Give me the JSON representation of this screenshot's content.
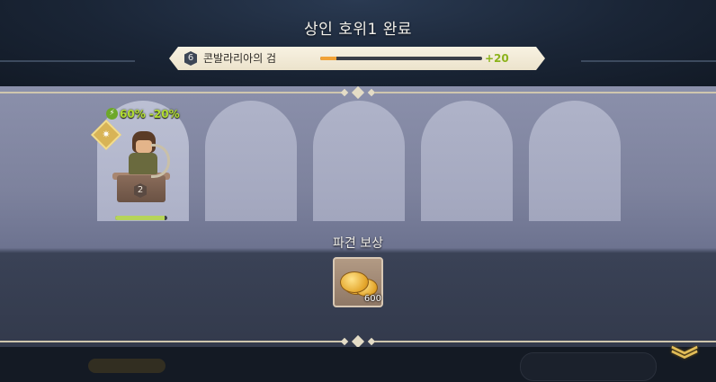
{
  "header": {
    "title": "상인 호위1 완료"
  },
  "info_bar": {
    "level": "6",
    "item_name": "콘발라리아의 검",
    "exp_progress": 0.1,
    "exp_gain": "+20"
  },
  "party": {
    "slots": [
      {
        "filled": true,
        "stat_text": "60% -20%",
        "hero_level": "2",
        "hp": 0.95
      },
      {
        "filled": false
      },
      {
        "filled": false
      },
      {
        "filled": false
      },
      {
        "filled": false
      }
    ]
  },
  "reward": {
    "title": "파견 보상",
    "item": "gold-coins-icon",
    "count": "600"
  },
  "footer": {
    "collapse_icon": "double-chevron-down-icon"
  },
  "colors": {
    "stat_green": "#b2dc33",
    "exp_fill": "#f1a236",
    "exp_gain": "#8db31c",
    "hp_fill": "#b6d45a",
    "gold": "#e2bd58"
  }
}
